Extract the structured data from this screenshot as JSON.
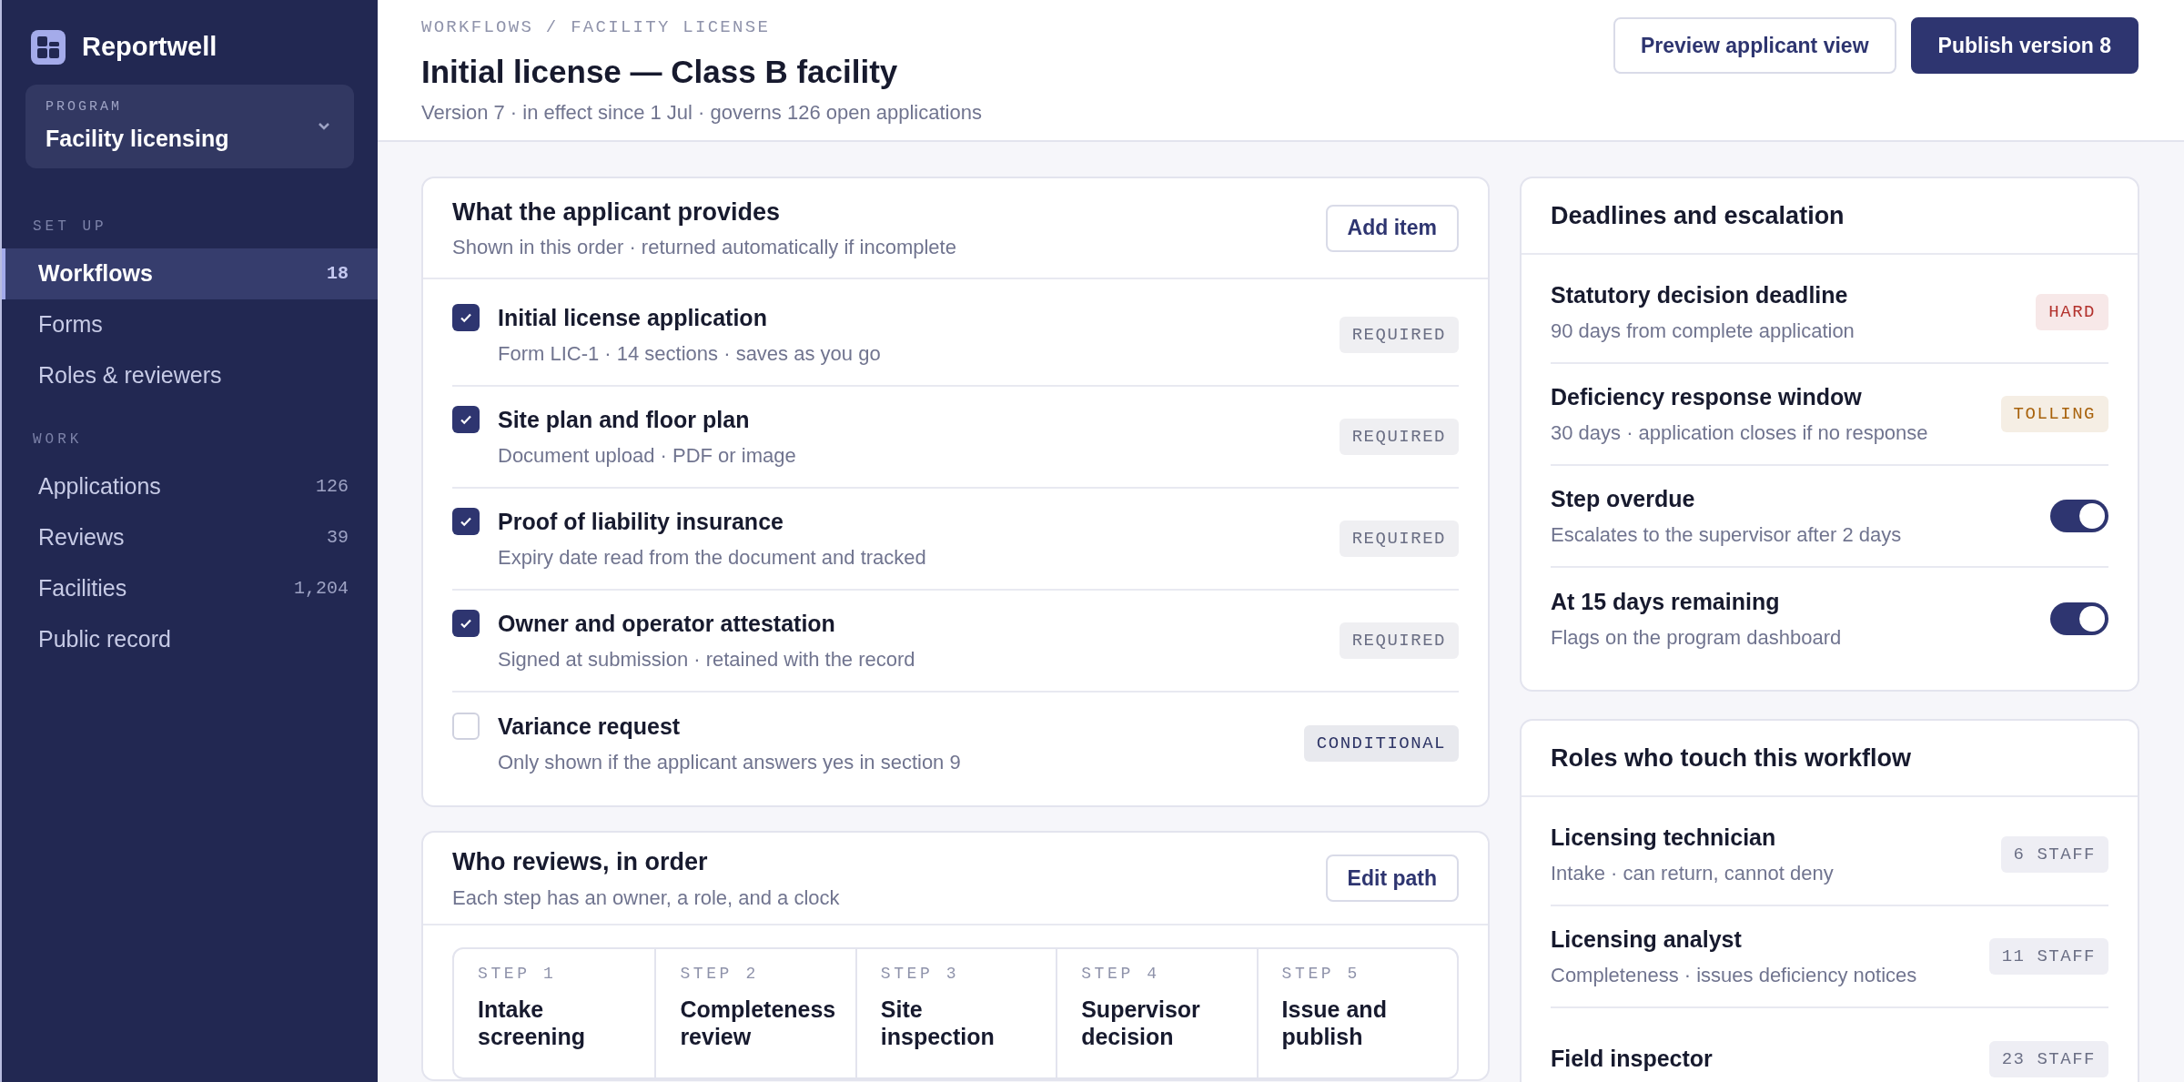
{
  "brand": {
    "name": "Reportwell"
  },
  "program": {
    "label": "PROGRAM",
    "value": "Facility licensing"
  },
  "sidebar": {
    "sections": [
      {
        "title": "SET UP",
        "items": [
          {
            "label": "Workflows",
            "count": "18",
            "selected": true
          },
          {
            "label": "Forms",
            "selected": false
          },
          {
            "label": "Roles & reviewers",
            "selected": false
          }
        ]
      },
      {
        "title": "WORK",
        "items": [
          {
            "label": "Applications",
            "count": "126",
            "selected": false
          },
          {
            "label": "Reviews",
            "count": "39",
            "selected": false
          },
          {
            "label": "Facilities",
            "count": "1,204",
            "selected": false
          },
          {
            "label": "Public record",
            "selected": false
          }
        ]
      }
    ]
  },
  "header": {
    "breadcrumb": "WORKFLOWS / FACILITY LICENSE",
    "title": "Initial license — Class B facility",
    "subtitle": "Version 7 · in effect since 1 Jul · governs 126 open applications",
    "buttons": [
      {
        "label": "Preview applicant view",
        "kind": "secondary"
      },
      {
        "label": "Publish version 8",
        "kind": "primary"
      }
    ]
  },
  "provides": {
    "title": "What the applicant provides",
    "subtitle": "Shown in this order · returned automatically if incomplete",
    "button": "Add item",
    "items": [
      {
        "title": "Initial license application",
        "detail": "Form LIC-1 · 14 sections · saves as you go",
        "checked": true,
        "tag": {
          "label": "REQUIRED",
          "color": "#6b6f85"
        }
      },
      {
        "title": "Site plan and floor plan",
        "detail": "Document upload · PDF or image",
        "checked": true,
        "tag": {
          "label": "REQUIRED",
          "color": "#6b6f85"
        }
      },
      {
        "title": "Proof of liability insurance",
        "detail": "Expiry date read from the document and tracked",
        "checked": true,
        "tag": {
          "label": "REQUIRED",
          "color": "#6b6f85"
        }
      },
      {
        "title": "Owner and operator attestation",
        "detail": "Signed at submission · retained with the record",
        "checked": true,
        "tag": {
          "label": "REQUIRED",
          "color": "#6b6f85"
        }
      },
      {
        "title": "Variance request",
        "detail": "Only shown if the applicant answers yes in section 9",
        "checked": false,
        "tag": {
          "label": "CONDITIONAL",
          "color": "#2e3566"
        }
      }
    ]
  },
  "reviews": {
    "title": "Who reviews, in order",
    "subtitle": "Each step has an owner, a role, and a clock",
    "button": "Edit path",
    "steps": [
      {
        "label": "STEP 1",
        "name": "Intake screening"
      },
      {
        "label": "STEP 2",
        "name": "Completeness review"
      },
      {
        "label": "STEP 3",
        "name": "Site inspection"
      },
      {
        "label": "STEP 4",
        "name": "Supervisor decision"
      },
      {
        "label": "STEP 5",
        "name": "Issue and publish"
      }
    ]
  },
  "deadlines": {
    "title": "Deadlines and escalation",
    "rows": [
      {
        "kind": "badge",
        "title": "Statutory decision deadline",
        "detail": "90 days from complete application",
        "tag": {
          "label": "HARD",
          "color": "#b3322d"
        }
      },
      {
        "kind": "badge",
        "title": "Deficiency response window",
        "detail": "30 days · application closes if no response",
        "tag": {
          "label": "TOLLING",
          "color": "#a8620c"
        }
      },
      {
        "kind": "toggle",
        "title": "Step overdue",
        "detail": "Escalates to the supervisor after 2 days",
        "on": true
      },
      {
        "kind": "toggle",
        "title": "At 15 days remaining",
        "detail": "Flags on the program dashboard",
        "on": true
      }
    ]
  },
  "roles": {
    "title": "Roles who touch this workflow",
    "rows": [
      {
        "title": "Licensing technician",
        "detail": "Intake · can return, cannot deny",
        "count": "6 STAFF"
      },
      {
        "title": "Licensing analyst",
        "detail": "Completeness · issues deficiency notices",
        "count": "11 STAFF"
      },
      {
        "title": "Field inspector",
        "count": "23 STAFF"
      }
    ]
  }
}
